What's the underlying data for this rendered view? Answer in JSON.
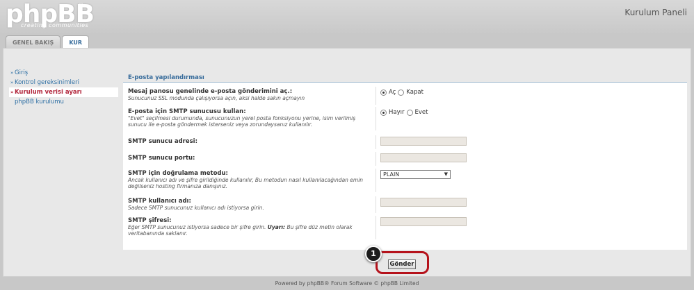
{
  "header": {
    "logo_text": "phpBB",
    "logo_reg": "®",
    "logo_sub": "creating communities",
    "panel_title": "Kurulum Paneli"
  },
  "tabs": [
    {
      "label": "GENEL BAKIŞ",
      "active": false
    },
    {
      "label": "KUR",
      "active": true
    }
  ],
  "menu": [
    {
      "label": "Giriş",
      "arrow": "»"
    },
    {
      "label": "Kontrol gereksinimleri",
      "arrow": "»"
    },
    {
      "label": "Kurulum verisi ayarı",
      "arrow": "»"
    },
    {
      "label": "phpBB kurulumu",
      "arrow": ""
    }
  ],
  "form": {
    "title": "E-posta yapılandırması",
    "rows": [
      {
        "label": "Mesaj panosu genelinde e-posta gönderimini aç.:",
        "hint": "Sunucunuz SSL modunda çalışıyorsa açın, aksi halde sakın açmayın",
        "option_a": "Aç",
        "option_b": "Kapat"
      },
      {
        "label": "E-posta için SMTP sunucusu kullan:",
        "hint": "\"Evet\" seçilmesi durumunda, sunucunuzun yerel posta fonksiyonu yerine, isim verilmiş sunucu ile e-posta göndermek isterseniz veya zorundaysanız kullanılır.",
        "option_a": "Hayır",
        "option_b": "Evet"
      },
      {
        "label": "SMTP sunucu adresi:",
        "hint": ""
      },
      {
        "label": "SMTP sunucu portu:",
        "hint": ""
      },
      {
        "label": "SMTP için doğrulama metodu:",
        "hint": "Ancak kullanıcı adı ve şifre girildiğinde kullanılır, Bu metodun nasıl kullanılacağından emin değilseniz hosting firmanıza danışınız.",
        "select_value": "PLAIN"
      },
      {
        "label": "SMTP kullanıcı adı:",
        "hint": "Sadece SMTP sunucunuz kullanıcı adı istiyorsa girin."
      },
      {
        "label": "SMTP şifresi:",
        "hint_a": "Eğer SMTP sunucunuz istiyorsa sadece bir şifre girin. ",
        "hint_warn": "Uyarı:",
        "hint_b": " Bu şifre düz metin olarak veritabanında saklanır."
      }
    ],
    "submit_label": "Gönder"
  },
  "annotation_marker": "1",
  "footer": "Powered by phpBB® Forum Software © phpBB Limited"
}
